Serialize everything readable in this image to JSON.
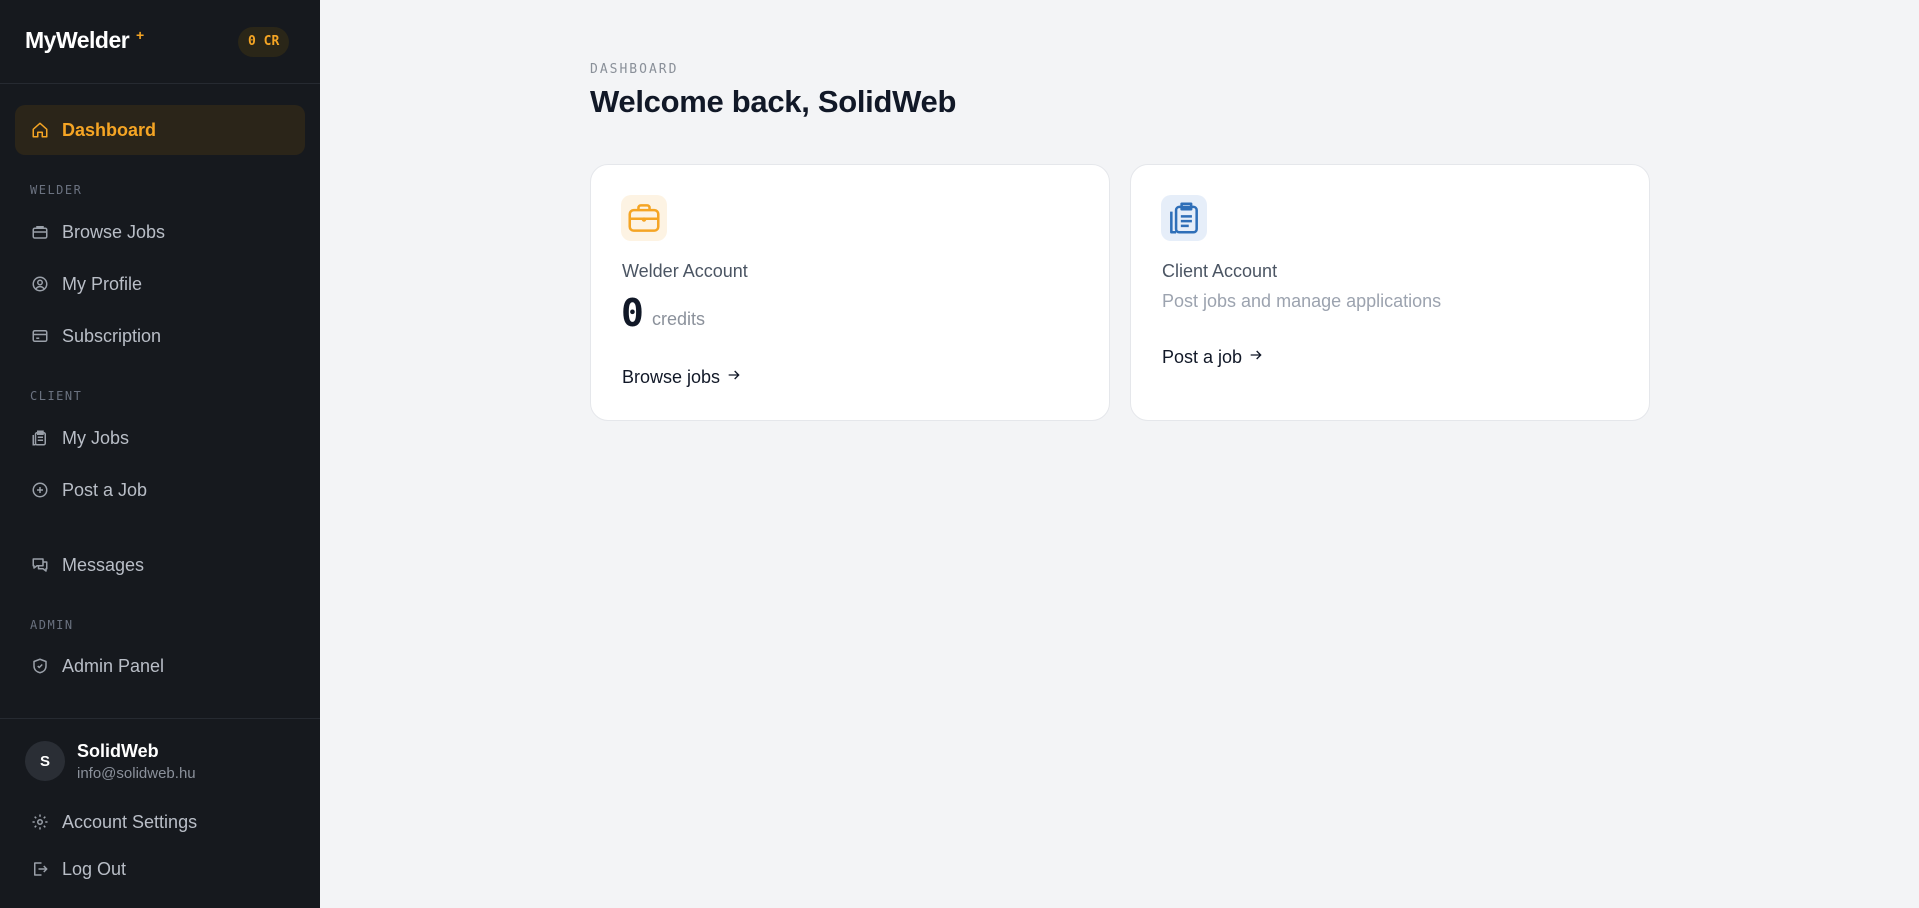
{
  "brand": {
    "name": "MyWelder",
    "star": "+",
    "credits_badge": "0 CR"
  },
  "sidebar": {
    "dashboard": "Dashboard",
    "sections": {
      "welder": "WELDER",
      "client": "CLIENT",
      "admin": "ADMIN"
    },
    "welder_items": [
      "Browse Jobs",
      "My Profile",
      "Subscription"
    ],
    "client_items": [
      "My Jobs",
      "Post a Job"
    ],
    "messages": "Messages",
    "admin_items": [
      "Admin Panel"
    ]
  },
  "user": {
    "initial": "S",
    "name": "SolidWeb",
    "email": "info@solidweb.hu"
  },
  "footer": {
    "settings": "Account Settings",
    "logout": "Log Out"
  },
  "main": {
    "eyebrow": "DASHBOARD",
    "title": "Welcome back, SolidWeb",
    "welder_card": {
      "title": "Welder Account",
      "credits": "0",
      "credits_unit": "credits",
      "link": "Browse jobs"
    },
    "client_card": {
      "title": "Client Account",
      "subtitle": "Post jobs and manage applications",
      "link": "Post a job"
    }
  },
  "colors": {
    "accent": "#f5a524",
    "sidebar_bg": "#16191e",
    "page_bg": "#f3f4f6",
    "client_icon": "#2f6fb8"
  },
  "icons": [
    "home-icon",
    "briefcase-icon",
    "user-circle-icon",
    "credit-card-icon",
    "clipboard-icon",
    "plus-circle-icon",
    "chat-icon",
    "shield-icon",
    "gear-icon",
    "logout-icon",
    "arrow-right-icon"
  ]
}
